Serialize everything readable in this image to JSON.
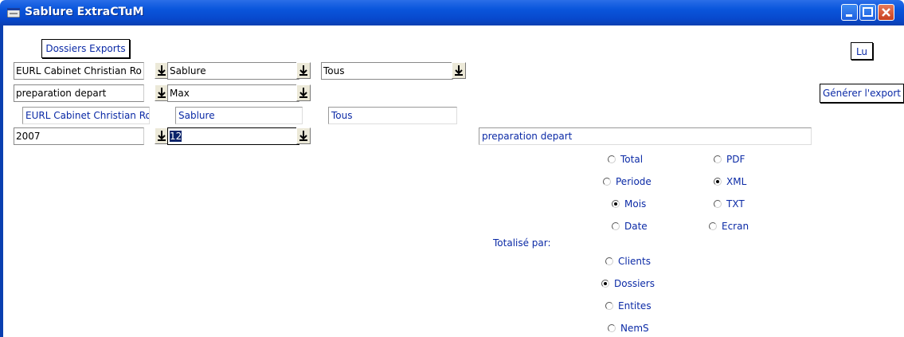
{
  "window": {
    "title": "Sablure ExtraCTuM"
  },
  "buttons": {
    "dossiers_exports": "Dossiers Exports",
    "lu": "Lu",
    "generer_export": "Générer l'export"
  },
  "combos": {
    "row1": [
      "EURL Cabinet Christian Ro",
      "Sablure",
      "Tous"
    ],
    "row2": [
      "preparation depart",
      "Max"
    ],
    "row4": [
      "2007",
      "12"
    ]
  },
  "fields": {
    "company": "EURL Cabinet Christian Ro",
    "site": "Sablure",
    "scope": "Tous",
    "export_name": "preparation depart"
  },
  "period_options": [
    "Total",
    "Periode",
    "Mois",
    "Date"
  ],
  "period_selected": "Mois",
  "format_options": [
    "PDF",
    "XML",
    "TXT",
    "Ecran"
  ],
  "format_selected": "XML",
  "totalise_label": "Totalisé par:",
  "totalise_options": [
    "Clients",
    "Dossiers",
    "Entites",
    "NemS"
  ],
  "totalise_selected": "Dossiers"
}
